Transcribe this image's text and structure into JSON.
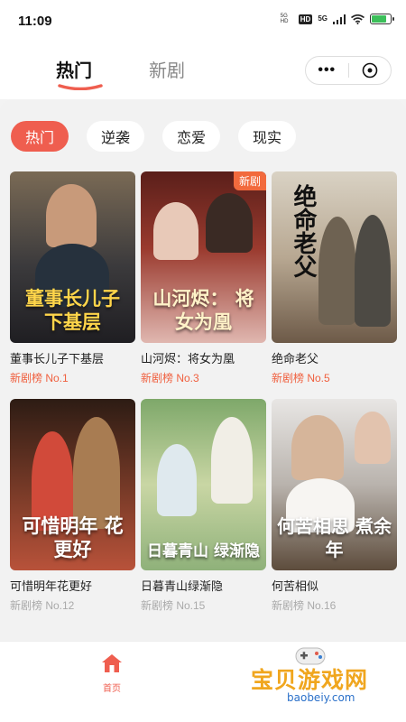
{
  "status_bar": {
    "time": "11:09",
    "mini_text": "5G HD",
    "network": "5G",
    "hd": "HD"
  },
  "header": {
    "tabs": [
      {
        "label": "热门"
      },
      {
        "label": "新剧"
      }
    ],
    "capsule": {
      "more": "•••"
    }
  },
  "chips": [
    {
      "label": "热门"
    },
    {
      "label": "逆袭"
    },
    {
      "label": "恋爱"
    },
    {
      "label": "现实"
    }
  ],
  "cards": [
    {
      "title": "董事长儿子下基层",
      "rank": "新剧榜 No.1",
      "poster_text": "董事长儿子 下基层",
      "badge": ""
    },
    {
      "title": "山河烬：将女为凰",
      "rank": "新剧榜 No.3",
      "poster_text": "山河烬： 将女为凰",
      "badge": "新剧"
    },
    {
      "title": "绝命老父",
      "rank": "新剧榜 No.5",
      "poster_text": "绝命老父",
      "badge": ""
    },
    {
      "title": "可惜明年花更好",
      "rank": "新剧榜 No.12",
      "poster_text": "可惜明年 花更好",
      "badge": ""
    },
    {
      "title": "日暮青山绿渐隐",
      "rank": "新剧榜 No.15",
      "poster_text": "日暮青山 绿渐隐",
      "badge": ""
    },
    {
      "title": "何苦相似",
      "rank": "新剧榜 No.16",
      "poster_text": "何苦相思 煮余年",
      "badge": ""
    }
  ],
  "bottom_nav": {
    "home_label": "首页"
  },
  "watermark": {
    "text": "宝贝游戏网",
    "url": "baobeiy.com"
  },
  "colors": {
    "accent": "#ef5e4f",
    "rank": "#f0603f",
    "badge": "#f26a3d"
  }
}
